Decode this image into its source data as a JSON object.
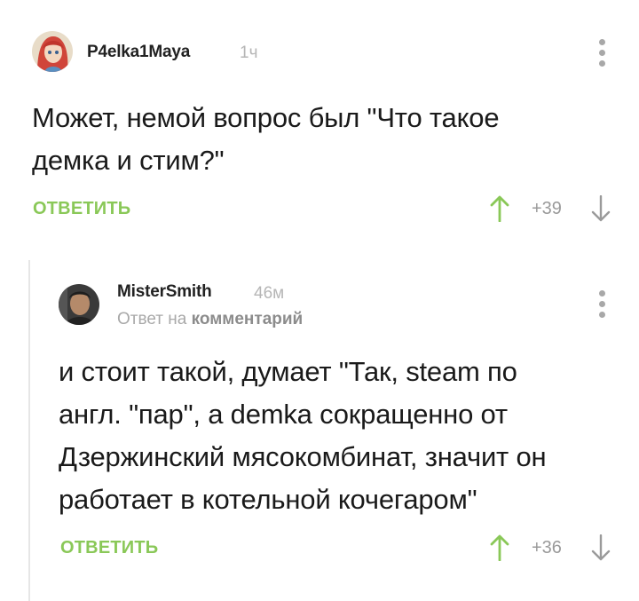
{
  "comments": [
    {
      "username": "P4elka1Maya",
      "time": "1ч",
      "text_lines": [
        "Может, немой вопрос был \"Что такое",
        "демка и стим?\""
      ],
      "reply_label": "ОТВЕТИТЬ",
      "score": "+39",
      "avatar_icon": "anime-avatar-icon"
    },
    {
      "username": "MisterSmith",
      "time": "46м",
      "reply_to_prefix": "Ответ на",
      "reply_to_link": "комментарий",
      "text_lines": [
        "и стоит такой, думает \"Так, steam по",
        "англ. \"пар\", а demka сокращенно от",
        "Дзержинский мясокомбинат, значит он",
        "работает в котельной кочегаром\""
      ],
      "reply_label": "ОТВЕТИТЬ",
      "score": "+36",
      "avatar_icon": "man-avatar-icon"
    }
  ],
  "colors": {
    "accent_green": "#8ac858",
    "muted_gray": "#9a9a9a"
  }
}
